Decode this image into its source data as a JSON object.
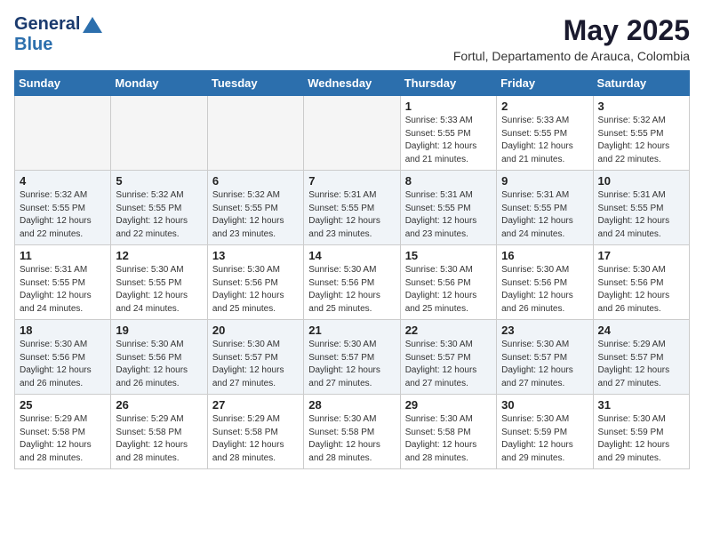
{
  "header": {
    "logo_line1": "General",
    "logo_line2": "Blue",
    "month_year": "May 2025",
    "location": "Fortul, Departamento de Arauca, Colombia"
  },
  "weekdays": [
    "Sunday",
    "Monday",
    "Tuesday",
    "Wednesday",
    "Thursday",
    "Friday",
    "Saturday"
  ],
  "weeks": [
    [
      {
        "day": "",
        "info": ""
      },
      {
        "day": "",
        "info": ""
      },
      {
        "day": "",
        "info": ""
      },
      {
        "day": "",
        "info": ""
      },
      {
        "day": "1",
        "info": "Sunrise: 5:33 AM\nSunset: 5:55 PM\nDaylight: 12 hours\nand 21 minutes."
      },
      {
        "day": "2",
        "info": "Sunrise: 5:33 AM\nSunset: 5:55 PM\nDaylight: 12 hours\nand 21 minutes."
      },
      {
        "day": "3",
        "info": "Sunrise: 5:32 AM\nSunset: 5:55 PM\nDaylight: 12 hours\nand 22 minutes."
      }
    ],
    [
      {
        "day": "4",
        "info": "Sunrise: 5:32 AM\nSunset: 5:55 PM\nDaylight: 12 hours\nand 22 minutes."
      },
      {
        "day": "5",
        "info": "Sunrise: 5:32 AM\nSunset: 5:55 PM\nDaylight: 12 hours\nand 22 minutes."
      },
      {
        "day": "6",
        "info": "Sunrise: 5:32 AM\nSunset: 5:55 PM\nDaylight: 12 hours\nand 23 minutes."
      },
      {
        "day": "7",
        "info": "Sunrise: 5:31 AM\nSunset: 5:55 PM\nDaylight: 12 hours\nand 23 minutes."
      },
      {
        "day": "8",
        "info": "Sunrise: 5:31 AM\nSunset: 5:55 PM\nDaylight: 12 hours\nand 23 minutes."
      },
      {
        "day": "9",
        "info": "Sunrise: 5:31 AM\nSunset: 5:55 PM\nDaylight: 12 hours\nand 24 minutes."
      },
      {
        "day": "10",
        "info": "Sunrise: 5:31 AM\nSunset: 5:55 PM\nDaylight: 12 hours\nand 24 minutes."
      }
    ],
    [
      {
        "day": "11",
        "info": "Sunrise: 5:31 AM\nSunset: 5:55 PM\nDaylight: 12 hours\nand 24 minutes."
      },
      {
        "day": "12",
        "info": "Sunrise: 5:30 AM\nSunset: 5:55 PM\nDaylight: 12 hours\nand 24 minutes."
      },
      {
        "day": "13",
        "info": "Sunrise: 5:30 AM\nSunset: 5:56 PM\nDaylight: 12 hours\nand 25 minutes."
      },
      {
        "day": "14",
        "info": "Sunrise: 5:30 AM\nSunset: 5:56 PM\nDaylight: 12 hours\nand 25 minutes."
      },
      {
        "day": "15",
        "info": "Sunrise: 5:30 AM\nSunset: 5:56 PM\nDaylight: 12 hours\nand 25 minutes."
      },
      {
        "day": "16",
        "info": "Sunrise: 5:30 AM\nSunset: 5:56 PM\nDaylight: 12 hours\nand 26 minutes."
      },
      {
        "day": "17",
        "info": "Sunrise: 5:30 AM\nSunset: 5:56 PM\nDaylight: 12 hours\nand 26 minutes."
      }
    ],
    [
      {
        "day": "18",
        "info": "Sunrise: 5:30 AM\nSunset: 5:56 PM\nDaylight: 12 hours\nand 26 minutes."
      },
      {
        "day": "19",
        "info": "Sunrise: 5:30 AM\nSunset: 5:56 PM\nDaylight: 12 hours\nand 26 minutes."
      },
      {
        "day": "20",
        "info": "Sunrise: 5:30 AM\nSunset: 5:57 PM\nDaylight: 12 hours\nand 27 minutes."
      },
      {
        "day": "21",
        "info": "Sunrise: 5:30 AM\nSunset: 5:57 PM\nDaylight: 12 hours\nand 27 minutes."
      },
      {
        "day": "22",
        "info": "Sunrise: 5:30 AM\nSunset: 5:57 PM\nDaylight: 12 hours\nand 27 minutes."
      },
      {
        "day": "23",
        "info": "Sunrise: 5:30 AM\nSunset: 5:57 PM\nDaylight: 12 hours\nand 27 minutes."
      },
      {
        "day": "24",
        "info": "Sunrise: 5:29 AM\nSunset: 5:57 PM\nDaylight: 12 hours\nand 27 minutes."
      }
    ],
    [
      {
        "day": "25",
        "info": "Sunrise: 5:29 AM\nSunset: 5:58 PM\nDaylight: 12 hours\nand 28 minutes."
      },
      {
        "day": "26",
        "info": "Sunrise: 5:29 AM\nSunset: 5:58 PM\nDaylight: 12 hours\nand 28 minutes."
      },
      {
        "day": "27",
        "info": "Sunrise: 5:29 AM\nSunset: 5:58 PM\nDaylight: 12 hours\nand 28 minutes."
      },
      {
        "day": "28",
        "info": "Sunrise: 5:30 AM\nSunset: 5:58 PM\nDaylight: 12 hours\nand 28 minutes."
      },
      {
        "day": "29",
        "info": "Sunrise: 5:30 AM\nSunset: 5:58 PM\nDaylight: 12 hours\nand 28 minutes."
      },
      {
        "day": "30",
        "info": "Sunrise: 5:30 AM\nSunset: 5:59 PM\nDaylight: 12 hours\nand 29 minutes."
      },
      {
        "day": "31",
        "info": "Sunrise: 5:30 AM\nSunset: 5:59 PM\nDaylight: 12 hours\nand 29 minutes."
      }
    ]
  ]
}
